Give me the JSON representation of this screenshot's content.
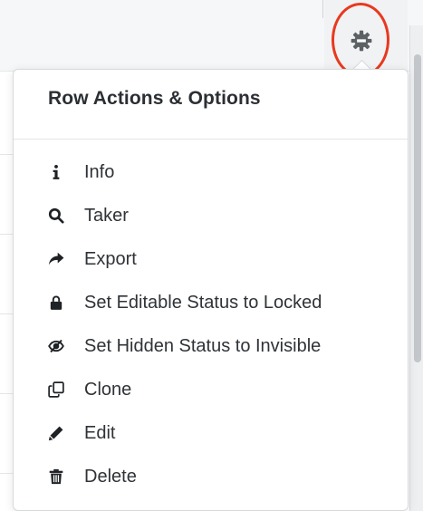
{
  "menu": {
    "title": "Row Actions & Options",
    "items": [
      {
        "label": "Info",
        "icon": "info-icon"
      },
      {
        "label": "Taker",
        "icon": "search-icon"
      },
      {
        "label": "Export",
        "icon": "share-arrow-icon"
      },
      {
        "label": "Set Editable Status to Locked",
        "icon": "lock-icon"
      },
      {
        "label": "Set Hidden Status to Invisible",
        "icon": "eye-slash-icon"
      },
      {
        "label": "Clone",
        "icon": "clone-icon"
      },
      {
        "label": "Edit",
        "icon": "pencil-icon"
      },
      {
        "label": "Delete",
        "icon": "trash-icon"
      }
    ]
  },
  "toolbar": {
    "settings_icon": "gear-icon"
  },
  "colors": {
    "highlight_circle": "#e8391f",
    "text": "#2f3337",
    "gear": "#5d6166"
  }
}
